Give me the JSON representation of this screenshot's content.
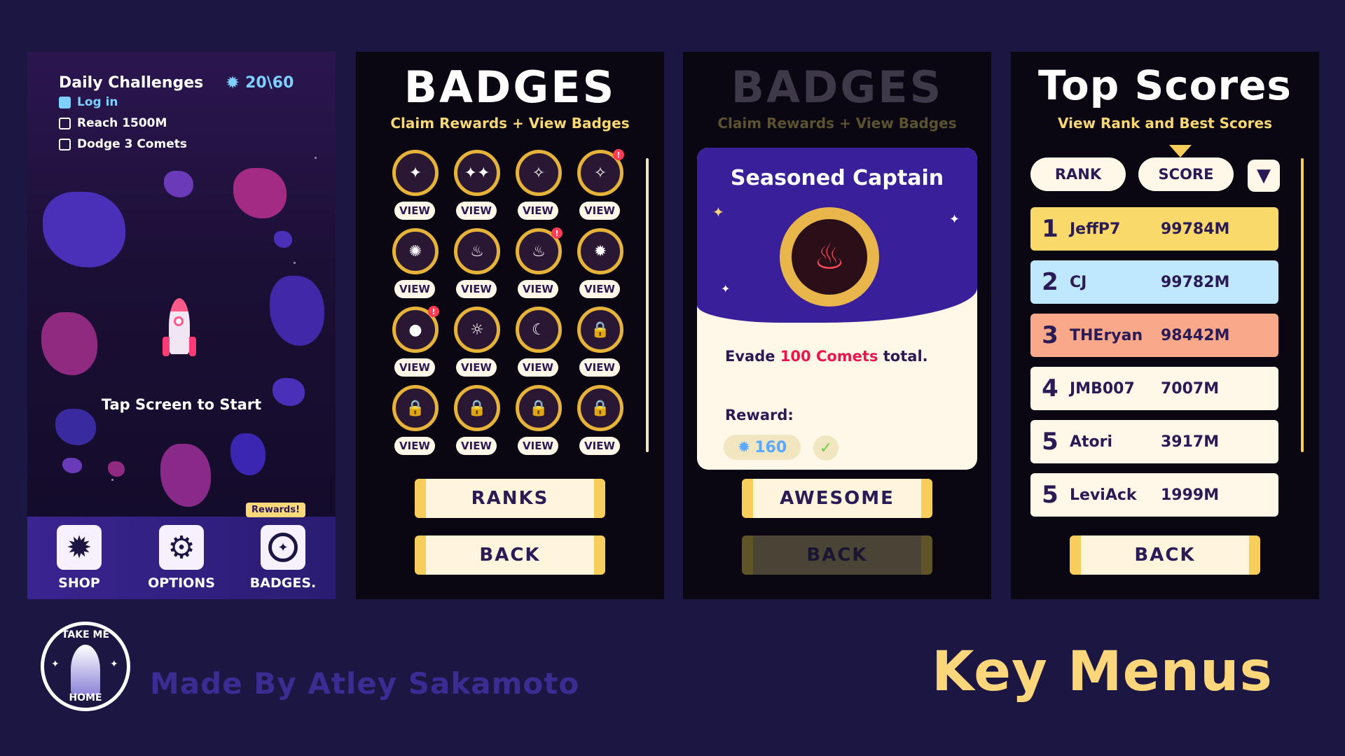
{
  "colors": {
    "background": "#1c1643",
    "accent_yellow": "#fbd67b",
    "accent_blue": "#7fd0ff",
    "navy": "#2a1a55"
  },
  "home": {
    "title": "Daily Challenges",
    "gem_icon": "gear-star-icon",
    "gems": "20\\60",
    "challenges": [
      {
        "label": "Log in",
        "done": true
      },
      {
        "label": "Reach 1500M",
        "done": false
      },
      {
        "label": "Dodge 3 Comets",
        "done": false
      }
    ],
    "tap_text": "Tap Screen to Start",
    "rewards_tag": "Rewards!",
    "menu": [
      {
        "label": "SHOP",
        "icon": "gear-star-icon"
      },
      {
        "label": "OPTIONS",
        "icon": "gear-icon"
      },
      {
        "label": "BADGES.",
        "icon": "badge-icon"
      }
    ]
  },
  "badges": {
    "title": "BADGES",
    "subtitle": "Claim Rewards + View Badges",
    "view_label": "VIEW",
    "ranks_label": "RANKS",
    "back_label": "BACK",
    "items": [
      {
        "icon": "sparkle-icon",
        "sym": "✦",
        "alert": false
      },
      {
        "icon": "double-sparkle-icon",
        "sym": "✦✦",
        "alert": false
      },
      {
        "icon": "triple-sparkle-icon",
        "sym": "✧",
        "alert": false
      },
      {
        "icon": "color-sparkle-icon",
        "sym": "✧",
        "alert": true
      },
      {
        "icon": "explosion-icon",
        "sym": "✺",
        "alert": false
      },
      {
        "icon": "comet-icon",
        "sym": "♨",
        "alert": false
      },
      {
        "icon": "double-comet-icon",
        "sym": "♨",
        "alert": true
      },
      {
        "icon": "blue-burst-icon",
        "sym": "✹",
        "alert": false
      },
      {
        "icon": "planet-icon",
        "sym": "●",
        "alert": true
      },
      {
        "icon": "sun-icon",
        "sym": "☼",
        "alert": false
      },
      {
        "icon": "moon-icon",
        "sym": "☾",
        "alert": false
      },
      {
        "icon": "lock-icon",
        "sym": "🔒",
        "alert": false
      },
      {
        "icon": "lock-icon",
        "sym": "🔒",
        "alert": false
      },
      {
        "icon": "lock-icon",
        "sym": "🔒",
        "alert": false
      },
      {
        "icon": "lock-icon",
        "sym": "🔒",
        "alert": false
      },
      {
        "icon": "lock-icon",
        "sym": "🔒",
        "alert": false
      }
    ]
  },
  "popup": {
    "bg_title": "BADGES",
    "bg_subtitle": "Claim Rewards + View Badges",
    "card_title": "Seasoned Captain",
    "desc_pre": "Evade ",
    "desc_highlight": "100 Comets",
    "desc_post": " total.",
    "reward_label": "Reward:",
    "reward_value": "160",
    "awesome_label": "AWESOME",
    "back_label": "BACK"
  },
  "scores": {
    "title": "Top Scores",
    "subtitle": "View Rank and Best Scores",
    "tab_rank": "RANK",
    "tab_score": "SCORE",
    "back_label": "BACK",
    "rows": [
      {
        "rank": "1",
        "name": "JeffP7",
        "score": "99784M",
        "color": "#f9d96a"
      },
      {
        "rank": "2",
        "name": "CJ",
        "score": "99782M",
        "color": "#bfe8ff"
      },
      {
        "rank": "3",
        "name": "THEryan",
        "score": "98442M",
        "color": "#f9a98a"
      },
      {
        "rank": "4",
        "name": "JMB007",
        "score": "7007M",
        "color": "#fff8e8"
      },
      {
        "rank": "5",
        "name": "Atori",
        "score": "3917M",
        "color": "#fff8e8"
      },
      {
        "rank": "5",
        "name": "LeviAck",
        "score": "1999M",
        "color": "#fff8e8"
      }
    ]
  },
  "footer": {
    "logo_top": "TAKE ME",
    "logo_bottom": "HOME",
    "credit": "Made By Atley Sakamoto",
    "heading": "Key Menus"
  }
}
